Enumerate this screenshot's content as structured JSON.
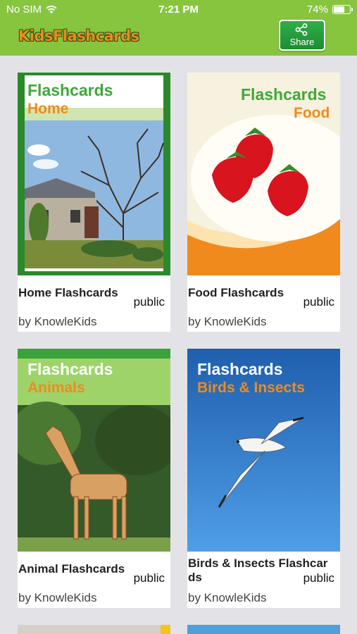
{
  "status": {
    "carrier": "No SIM",
    "time": "7:21 PM",
    "battery_percent": "74%",
    "battery_level": 0.74
  },
  "nav": {
    "logo": "KidsFlashcards",
    "share_label": "Share"
  },
  "cards": [
    {
      "cover_title": "Flashcards",
      "cover_subtitle": "Home",
      "name": "Home Flashcards",
      "visibility": "public",
      "author": "by KnowleKids"
    },
    {
      "cover_title": "Flashcards",
      "cover_subtitle": "Food",
      "name": "Food Flashcards",
      "visibility": "public",
      "author": "by KnowleKids"
    },
    {
      "cover_title": "Flashcards",
      "cover_subtitle": "Animals",
      "name": "Animal Flashcards",
      "visibility": "public",
      "author": "by KnowleKids"
    },
    {
      "cover_title": "Flashcards",
      "cover_subtitle": "Birds & Insects",
      "name_line1": "Birds & Insects Flashcar",
      "name_line2": "ds",
      "visibility": "public",
      "author": "by KnowleKids"
    }
  ]
}
